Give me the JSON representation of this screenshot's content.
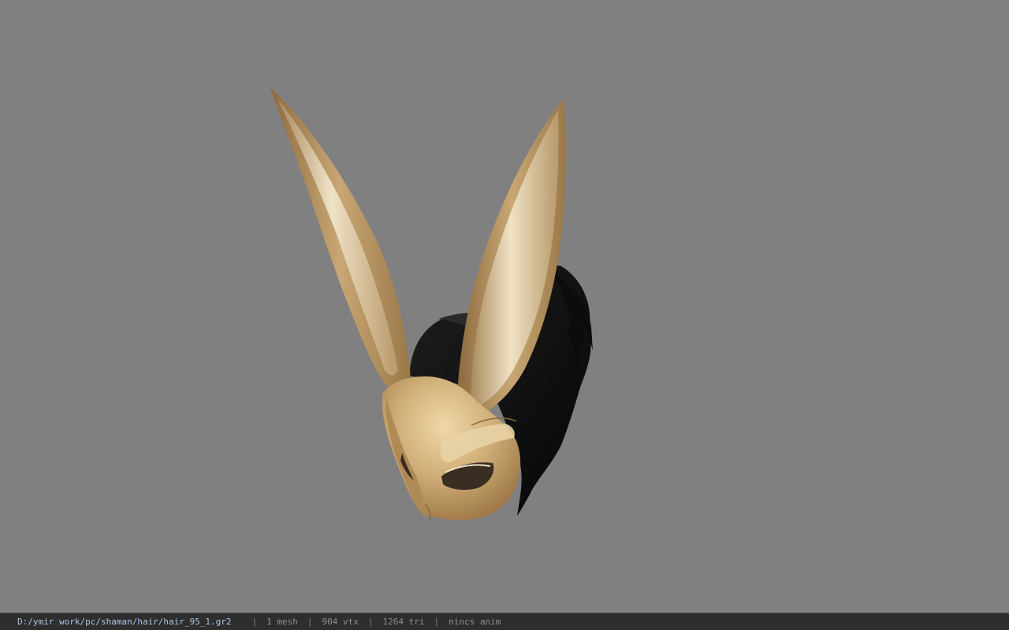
{
  "viewport": {
    "background_color": "#808080",
    "model": {
      "name": "bunny-ear-mask-hair-model",
      "mask_color": "#c8a572",
      "hair_color": "#111111"
    }
  },
  "status_bar": {
    "file_path": "D:/ymir work/pc/shaman/hair/hair_95_1.gr2",
    "separator": "|",
    "mesh_count": "1 mesh",
    "vertex_count": "904 vtx",
    "triangle_count": "1264 tri",
    "animation": "nincs anim"
  }
}
